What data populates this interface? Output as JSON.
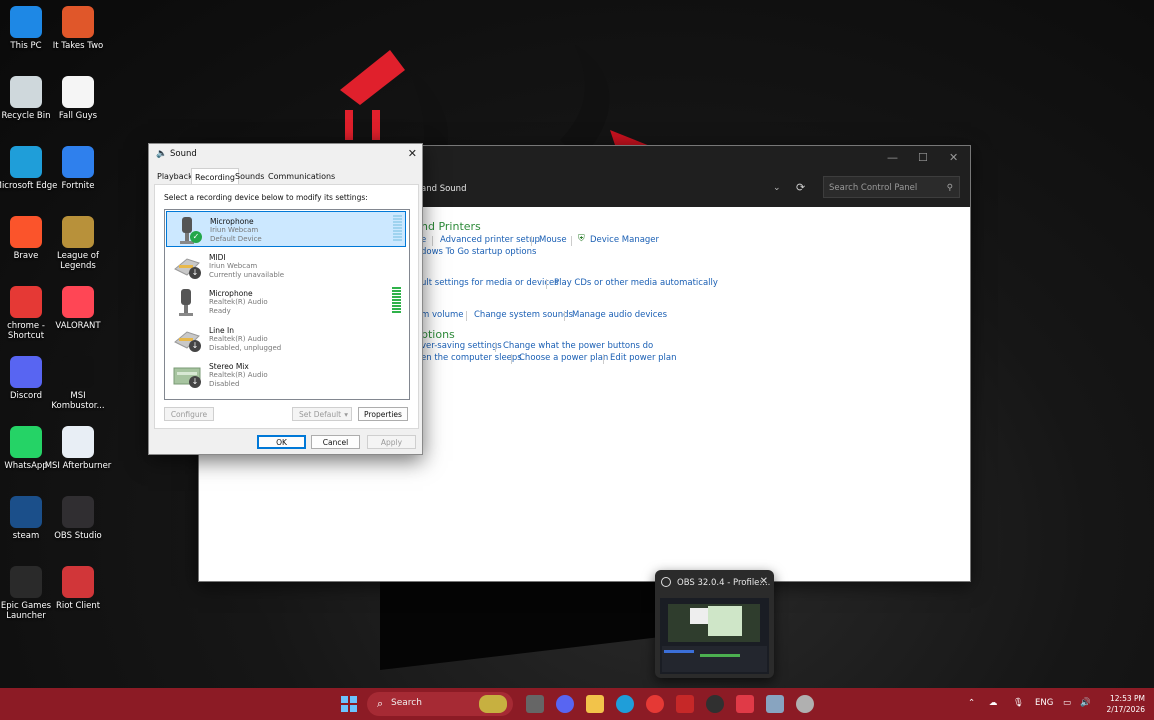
{
  "desktop": {
    "icons": [
      {
        "label": "This PC",
        "icon": "monitor-icon",
        "color": "#1e88e5"
      },
      {
        "label": "It Takes Two",
        "icon": "game-icon",
        "color": "#e0572a"
      },
      {
        "label": "Recycle Bin",
        "icon": "recycle-bin-icon",
        "color": "#cfd8dc"
      },
      {
        "label": "Fall Guys",
        "icon": "file-icon",
        "color": "#f5f5f5"
      },
      {
        "label": "Microsoft Edge",
        "icon": "edge-icon",
        "color": "#1f9ed9"
      },
      {
        "label": "Fortnite",
        "icon": "fortnite-icon",
        "color": "#2f80ed"
      },
      {
        "label": "Brave",
        "icon": "brave-icon",
        "color": "#fb542b"
      },
      {
        "label": "League of Legends",
        "icon": "league-icon",
        "color": "#b8913a"
      },
      {
        "label": "chrome - Shortcut",
        "icon": "chrome-icon",
        "color": "#e53935"
      },
      {
        "label": "VALORANT",
        "icon": "valorant-icon",
        "color": "#ff4655"
      },
      {
        "label": "Discord",
        "icon": "discord-icon",
        "color": "#5865f2"
      },
      {
        "label": "MSI Kombustor...",
        "icon": "kombustor-icon",
        "color": "#111111"
      },
      {
        "label": "WhatsApp",
        "icon": "whatsapp-icon",
        "color": "#25d366"
      },
      {
        "label": "MSI Afterburner",
        "icon": "afterburner-icon",
        "color": "#e8eef5"
      },
      {
        "label": "steam",
        "icon": "steam-icon",
        "color": "#1b4f8a"
      },
      {
        "label": "OBS Studio",
        "icon": "obs-icon",
        "color": "#302e31"
      },
      {
        "label": "Epic Games Launcher",
        "icon": "epic-icon",
        "color": "#2a2a2a"
      },
      {
        "label": "Riot Client",
        "icon": "riot-icon",
        "color": "#d13639"
      }
    ]
  },
  "control_panel": {
    "breadcrumb": "and Sound",
    "search_placeholder": "Search Control Panel",
    "sections": {
      "devices_heading": "nd Printers",
      "links_row1": [
        "e",
        "Advanced printer setup",
        "Mouse",
        "Device Manager"
      ],
      "link_row1b": "dows To Go startup options",
      "links_row2": [
        "ult settings for media or devices",
        "Play CDs or other media automatically"
      ],
      "links_row3": [
        "m volume",
        "Change system sounds",
        "Manage audio devices"
      ],
      "power_heading": "ptions",
      "links_row4": [
        "ver-saving settings",
        "Change what the power buttons do"
      ],
      "links_row5": [
        "en the computer sleeps",
        "Choose a power plan",
        "Edit power plan"
      ]
    }
  },
  "sound_dialog": {
    "title": "Sound",
    "tabs": [
      "Playback",
      "Recording",
      "Sounds",
      "Communications"
    ],
    "active_tab": "Recording",
    "instruction": "Select a recording device below to modify its settings:",
    "devices": [
      {
        "name": "Microphone",
        "driver": "Iriun Webcam",
        "status": "Default Device",
        "selected": true,
        "badge": "check",
        "meter_level": 0.0
      },
      {
        "name": "MIDI",
        "driver": "Iriun Webcam",
        "status": "Currently unavailable",
        "selected": false,
        "badge": "down",
        "meter_level": null
      },
      {
        "name": "Microphone",
        "driver": "Realtek(R) Audio",
        "status": "Ready",
        "selected": false,
        "badge": "none",
        "meter_level": 1.0
      },
      {
        "name": "Line In",
        "driver": "Realtek(R) Audio",
        "status": "Disabled, unplugged",
        "selected": false,
        "badge": "down",
        "meter_level": null
      },
      {
        "name": "Stereo Mix",
        "driver": "Realtek(R) Audio",
        "status": "Disabled",
        "selected": false,
        "badge": "down",
        "meter_level": null
      }
    ],
    "buttons": {
      "configure": "Configure",
      "set_default": "Set Default",
      "properties": "Properties",
      "ok": "OK",
      "cancel": "Cancel",
      "apply": "Apply"
    }
  },
  "obs_preview": {
    "title": "OBS 32.0.4 - Profile:..."
  },
  "taskbar": {
    "search_label": "Search",
    "language": "ENG",
    "time": "12:53 PM",
    "date": "2/17/2026",
    "accent": "#8c1b25"
  }
}
